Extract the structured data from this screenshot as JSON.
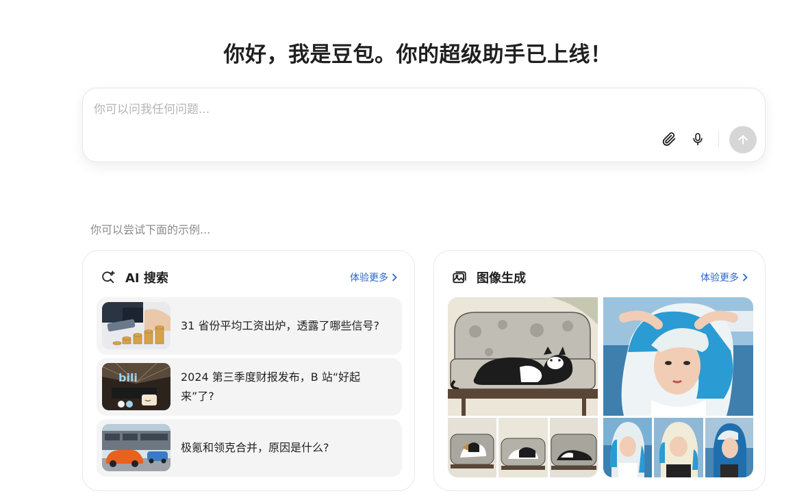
{
  "headline": "你好，我是豆包。你的超级助手已上线！",
  "composer": {
    "placeholder": "你可以问我任何问题...",
    "attach_icon": "paperclip-icon",
    "mic_icon": "microphone-icon",
    "send_icon": "arrow-up-icon"
  },
  "examples_label": "你可以尝试下面的示例...",
  "cards": {
    "search": {
      "title": "AI 搜索",
      "more": "体验更多",
      "icon": "ai-search-icon",
      "items": [
        {
          "text": "31 省份平均工资出炉，透露了哪些信号?"
        },
        {
          "text": "2024 第三季度财报发布，B 站“好起来”了?"
        },
        {
          "text": "极氪和领克合并，原因是什么?"
        }
      ]
    },
    "image": {
      "title": "图像生成",
      "more": "体验更多",
      "icon": "image-gallery-icon"
    }
  },
  "colors": {
    "link": "#2b66c9",
    "send_disabled": "#d6d6d6",
    "item_bg": "#f4f4f4"
  }
}
